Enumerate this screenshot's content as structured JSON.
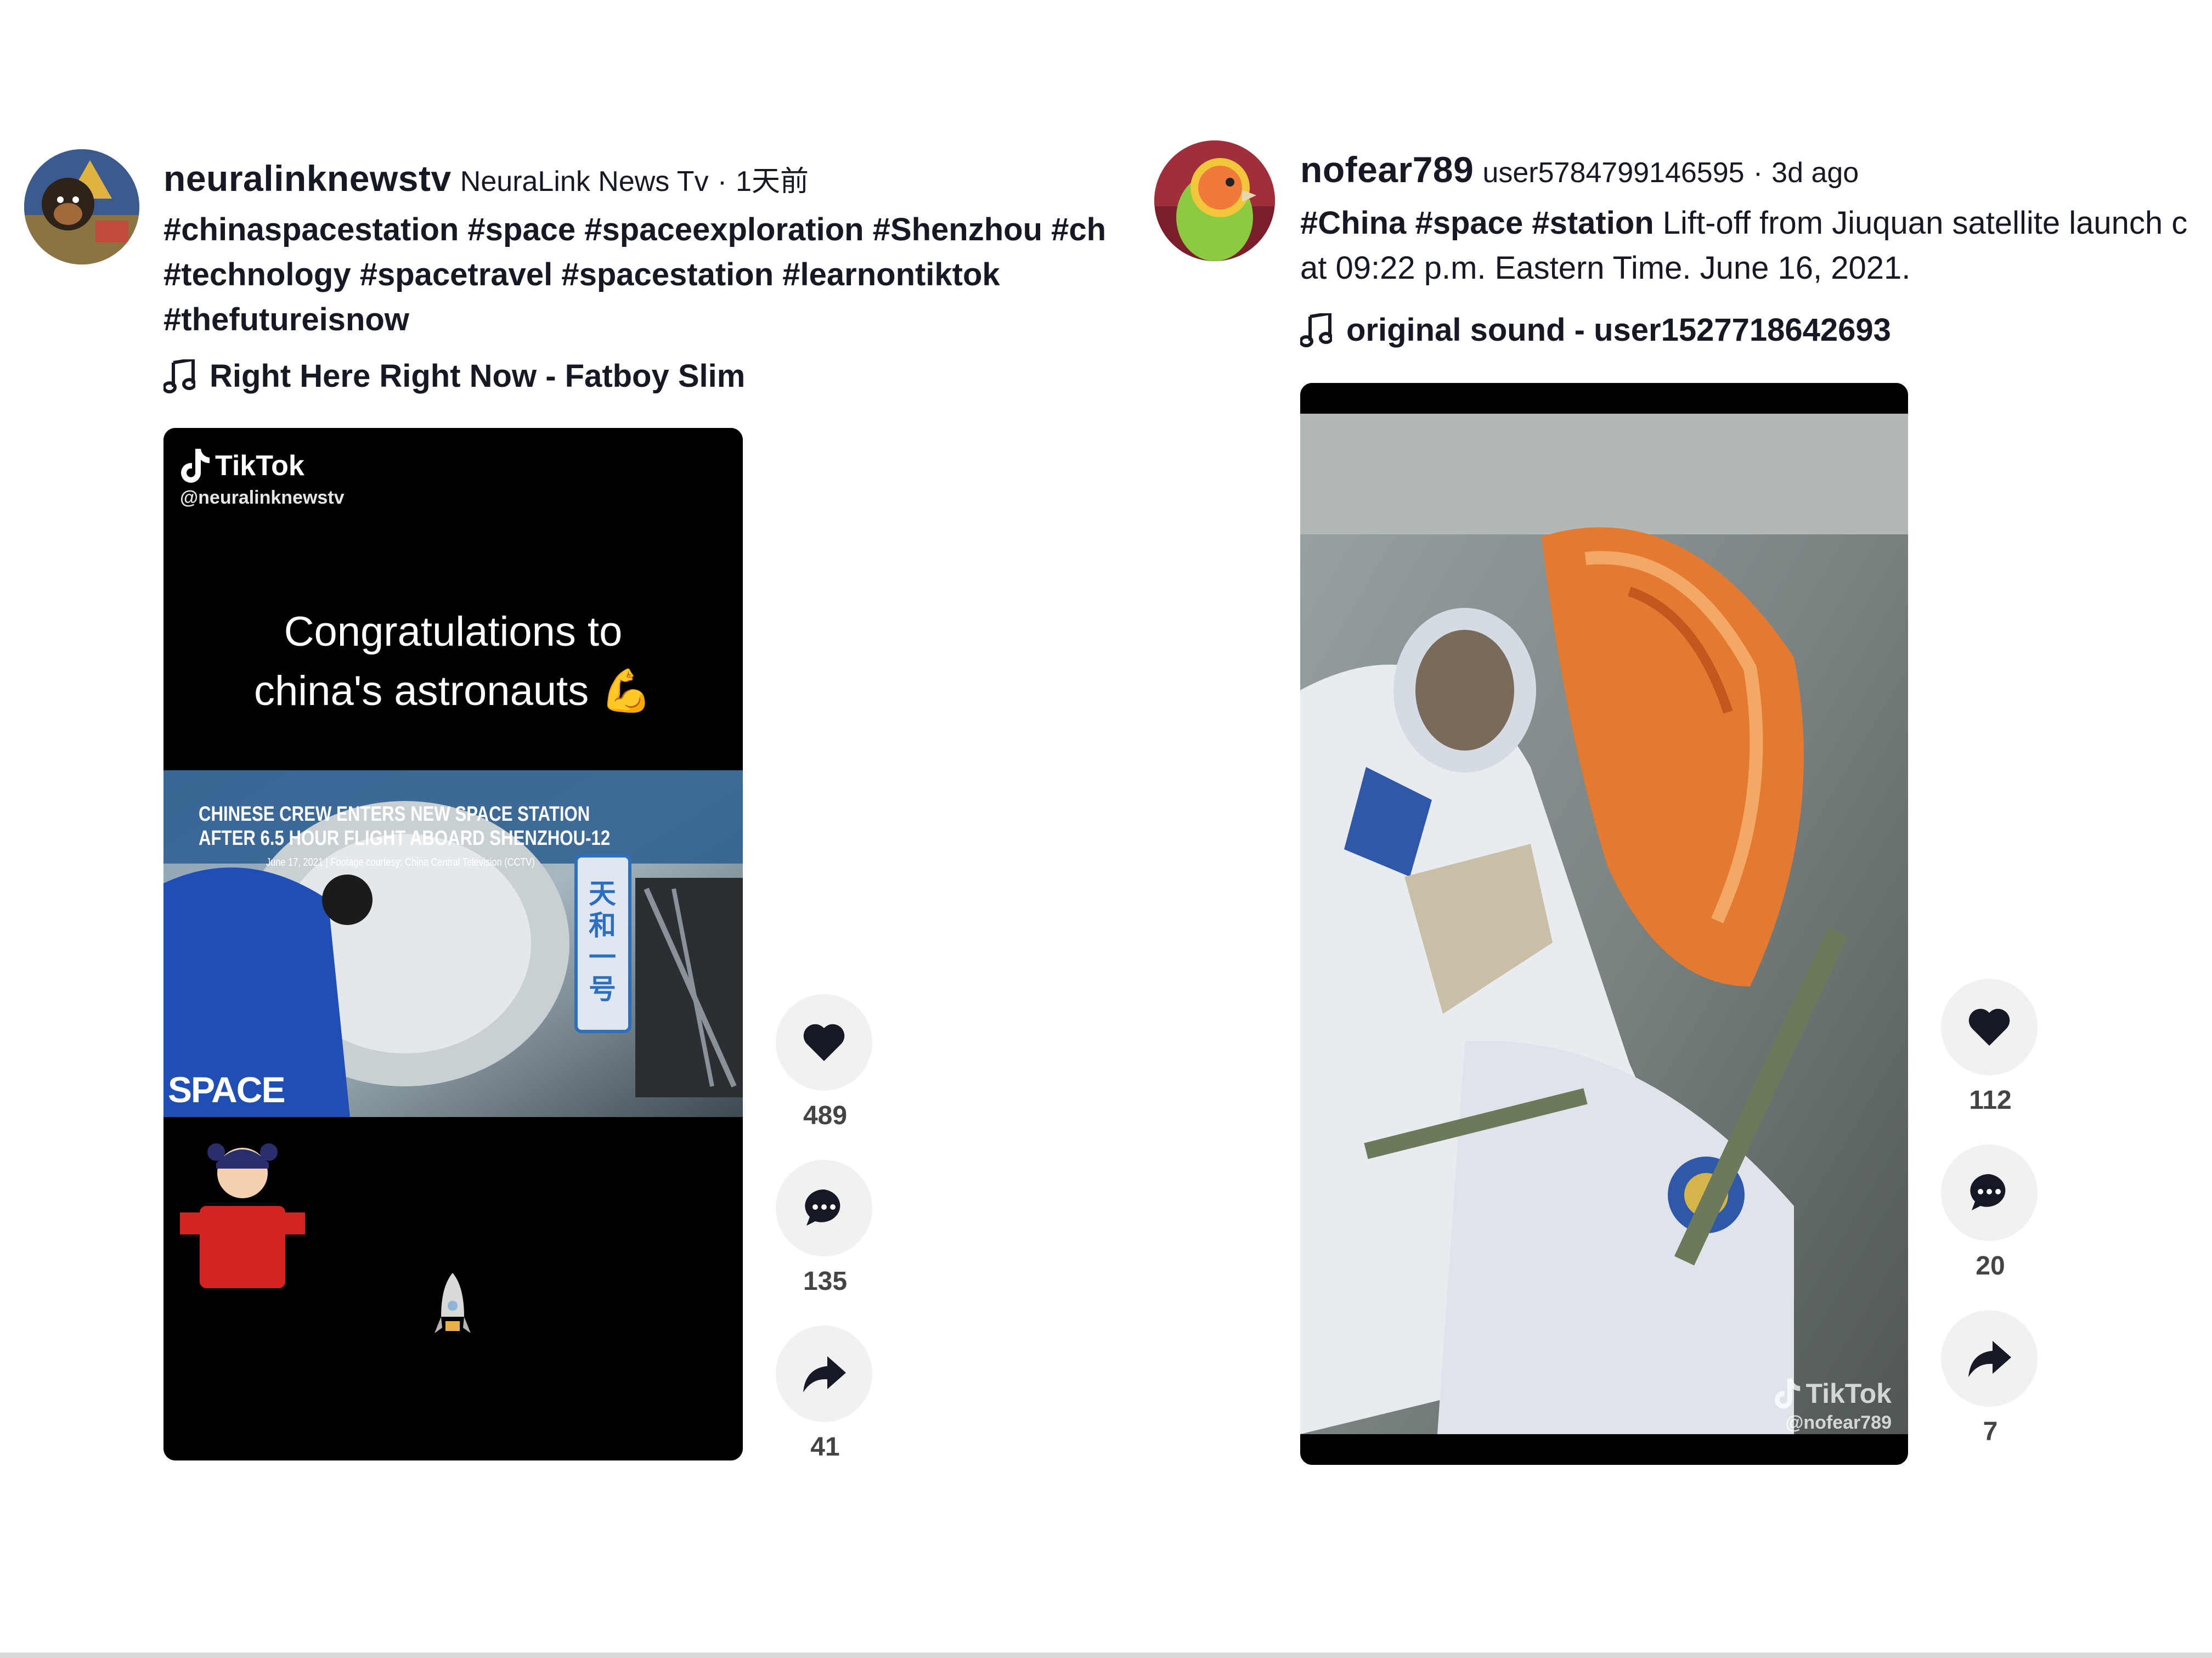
{
  "posts": [
    {
      "username": "neuralinknewstv",
      "nickname": "NeuraLink News Tv",
      "time": "1天前",
      "caption_lines": [
        "#chinaspacestation #space #spaceexploration #Shenzhou #china",
        "#technology #spacetravel #spacestation #learnontiktok",
        "#thefutureisnow"
      ],
      "music": "Right Here Right Now - Fatboy Slim",
      "video": {
        "watermark_brand": "TikTok",
        "watermark_handle": "@neuralinknewstv",
        "overlay_text_line1": "Congratulations to",
        "overlay_text_line2": "china's astronauts 💪",
        "news_headline_1": "CHINESE CREW ENTERS NEW SPACE STATION",
        "news_headline_2": "AFTER 6.5 HOUR FLIGHT ABOARD SHENZHOU-12",
        "news_credit": "June 17, 2021 | Footage courtesy: China Central Television (CCTV)",
        "station_sign": "天和一号",
        "space_logo": "SPACE"
      },
      "likes": "489",
      "comments": "135",
      "shares": "41"
    },
    {
      "username": "nofear789",
      "nickname": "user5784799146595",
      "time": "3d ago",
      "caption_tags": "#China #space #station",
      "caption_text": " Lift-off from Jiuquan satellite launch c",
      "caption_line2": "at 09:22 p.m. Eastern Time. June 16, 2021.",
      "music": "original sound - user1527718642693",
      "video": {
        "watermark_brand": "TikTok",
        "watermark_handle": "@nofear789"
      },
      "likes": "112",
      "comments": "20",
      "shares": "7"
    }
  ],
  "separator": "·",
  "icons": {
    "like": "heart-icon",
    "comment": "comment-bubble-icon",
    "share": "share-arrow-icon",
    "music": "music-note-icon"
  },
  "colors": {
    "background": "#ffffff",
    "text": "#161823",
    "action_bg": "#f1f1f2",
    "count_text": "#444444"
  }
}
